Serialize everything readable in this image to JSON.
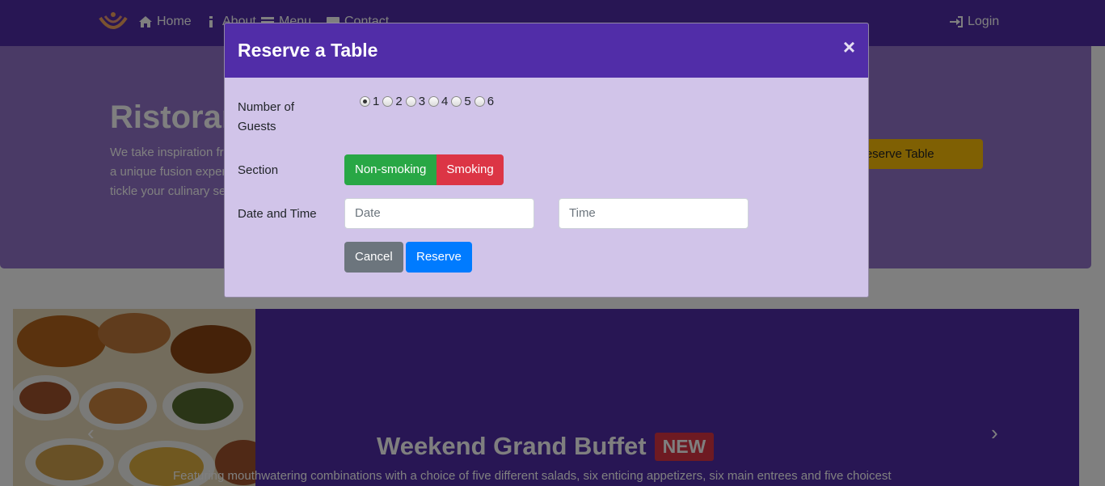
{
  "navbar": {
    "items": [
      {
        "label": "Home",
        "icon": "home-icon"
      },
      {
        "label": "About",
        "icon": "info-icon"
      },
      {
        "label": "Menu",
        "icon": "list-icon"
      },
      {
        "label": "Contact",
        "icon": "address-card-icon"
      }
    ],
    "login": {
      "label": "Login",
      "icon": "sign-in-icon"
    },
    "color": "#512da8"
  },
  "jumbotron": {
    "title": "Ristorante con Fusion",
    "text": "We take inspiration from the World's best cuisines, and create a unique fusion experience. Our lipsmacking creations will tickle your culinary senses!",
    "reserve_button": "Reserve Table",
    "color": "#9575cd"
  },
  "carousel": {
    "title": "Weekend Grand Buffet",
    "badge": "NEW",
    "caption": "Featuring mouthwatering combinations with a choice of five different salads, six enticing appetizers, six main entrees and five choicest"
  },
  "modal": {
    "title": "Reserve a Table",
    "close": "×",
    "header_color": "#512da8",
    "body_color": "#d1c4e9",
    "guests": {
      "label": "Number of Guests",
      "options": [
        "1",
        "2",
        "3",
        "4",
        "5",
        "6"
      ],
      "selected": "1"
    },
    "section": {
      "label": "Section",
      "non_smoking": "Non-smoking",
      "smoking": "Smoking"
    },
    "datetime": {
      "label": "Date and Time",
      "date_placeholder": "Date",
      "time_placeholder": "Time"
    },
    "actions": {
      "cancel": "Cancel",
      "reserve": "Reserve"
    }
  }
}
